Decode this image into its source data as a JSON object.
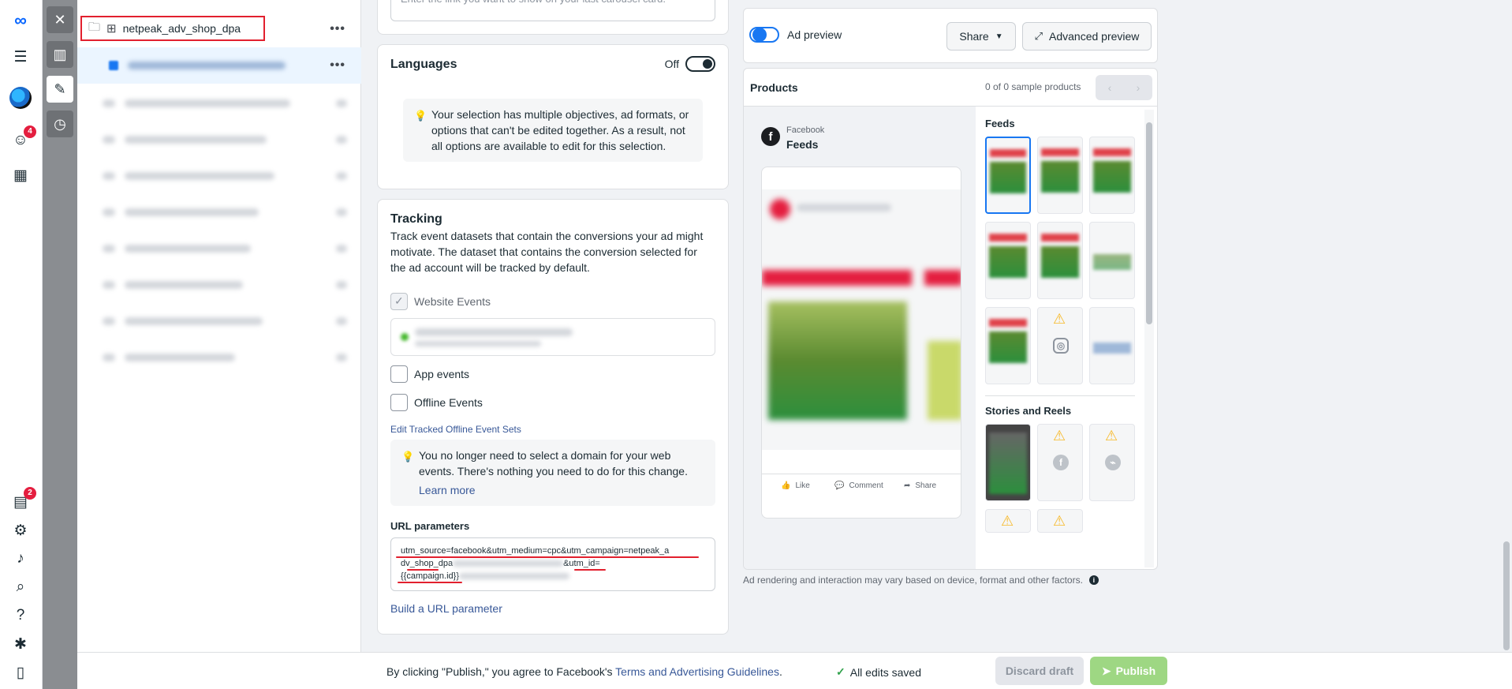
{
  "sidebar_rail": {
    "notifications_badge": "4",
    "pages_badge": "2"
  },
  "tree": {
    "campaign_name": "netpeak_adv_shop_dpa",
    "more": "•••"
  },
  "top_card": {
    "placeholder": "Enter the link you want to show on your last carousel card."
  },
  "languages": {
    "title": "Languages",
    "state": "Off",
    "note": "Your selection has multiple objectives, ad formats, or options that can't be edited together. As a result, not all options are available to edit for this selection."
  },
  "tracking": {
    "title": "Tracking",
    "description": "Track event datasets that contain the conversions your ad might motivate. The dataset that contains the conversion selected for the ad account will be tracked by default.",
    "website_events": "Website Events",
    "app_events": "App events",
    "offline_events": "Offline Events",
    "edit_offline_link": "Edit Tracked Offline Event Sets",
    "domain_note": "You no longer need to select a domain for your web events. There's nothing you need to do for this change.",
    "learn_more": "Learn more",
    "url_params_label": "URL parameters",
    "url_params_value_1": "utm_source=facebook&utm_medium=cpc&utm_campaign=netpeak_a",
    "url_params_value_2": "dv_shop_dpa",
    "url_params_value_3": "&utm_id=",
    "url_params_value_4": "{{campaign.id}}",
    "build_url_link": "Build a URL parameter"
  },
  "preview": {
    "ad_preview_label": "Ad preview",
    "share_label": "Share",
    "advanced_preview_label": "Advanced preview",
    "products_label": "Products",
    "sample_count": "0 of 0 sample products",
    "platform": "Facebook",
    "placement": "Feeds",
    "like": "Like",
    "comment": "Comment",
    "share": "Share",
    "feeds_heading": "Feeds",
    "stories_heading": "Stories and Reels",
    "disclaimer": "Ad rendering and interaction may vary based on device, format and other factors."
  },
  "footer": {
    "agree_prefix": "By clicking \"Publish,\" you agree to Facebook's ",
    "terms_link": "Terms and Advertising Guidelines",
    "agree_suffix": ".",
    "saved_status": "All edits saved",
    "discard_label": "Discard draft",
    "publish_label": "Publish"
  },
  "colors": {
    "accent": "#1877f2",
    "highlight_red": "#e2202e",
    "publish_green": "#9ed783"
  }
}
